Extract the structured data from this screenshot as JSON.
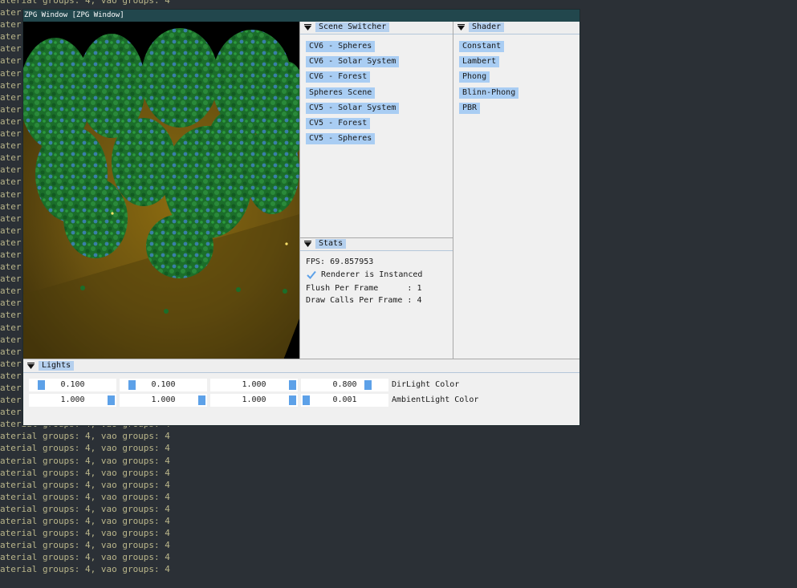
{
  "console": {
    "lines": [
      "aterial groups: 4, vao groups: 4",
      "ater",
      "ater",
      "ater",
      "ater",
      "ater",
      "ater",
      "ater",
      "ater",
      "ater",
      "ater",
      "ater",
      "ater",
      "ater",
      "ater",
      "ater",
      "ater",
      "ater",
      "ater",
      "ater",
      "ater",
      "ater",
      "ater",
      "ater",
      "ater",
      "ater",
      "ater",
      "ater",
      "ater",
      "ater",
      "ater",
      "ater",
      "ater",
      "ater",
      "ater",
      "aterial groups: 4, vao groups: 4",
      "aterial groups: 4, vao groups: 4",
      "aterial groups: 4, vao groups: 4",
      "aterial groups: 4, vao groups: 4",
      "aterial groups: 4, vao groups: 4",
      "aterial groups: 4, vao groups: 4",
      "aterial groups: 4, vao groups: 4",
      "aterial groups: 4, vao groups: 4",
      "aterial groups: 4, vao groups: 4",
      "aterial groups: 4, vao groups: 4",
      "aterial groups: 4, vao groups: 4",
      "aterial groups: 4, vao groups: 4",
      "aterial groups: 4, vao groups: 4"
    ]
  },
  "window": {
    "title": "ZPG Window [ZPG Window]"
  },
  "scene_switcher": {
    "title": "Scene Switcher",
    "items": [
      "CV6 - Spheres",
      "CV6 - Solar System",
      "CV6 - Forest",
      "Spheres Scene",
      "CV5 - Solar System",
      "CV5 - Forest",
      "CV5 - Spheres"
    ]
  },
  "shader": {
    "title": "Shader",
    "items": [
      "Constant",
      "Lambert",
      "Phong",
      "Blinn-Phong",
      "PBR"
    ]
  },
  "stats": {
    "title": "Stats",
    "fps": "FPS: 69.857953",
    "instanced": "Renderer is Instanced",
    "flush": "Flush Per Frame      : 1",
    "draw_calls": "Draw Calls Per Frame : 4"
  },
  "lights": {
    "title": "Lights",
    "dir_label": "DirLight Color",
    "dir_values": [
      "0.100",
      "0.100",
      "1.000",
      "0.800"
    ],
    "ambient_label": "AmbientLight Color",
    "ambient_values": [
      "1.000",
      "1.000",
      "1.000",
      "0.001"
    ]
  },
  "colors": {
    "accent": "#5da1e8",
    "item_bg": "#a9cdf3",
    "titlebar": "#22474d",
    "console_text": "#b9b58a",
    "console_bg": "#2b3036"
  }
}
